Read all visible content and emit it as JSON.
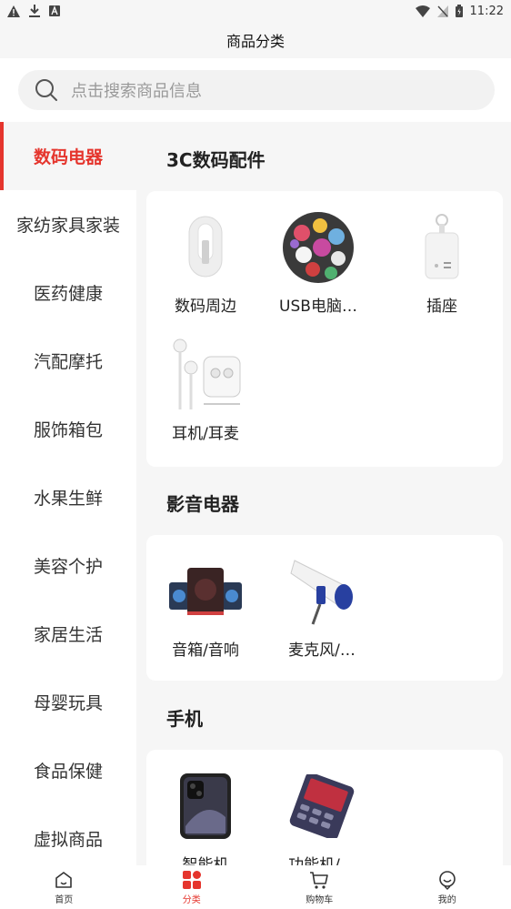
{
  "status_bar": {
    "time": "11:22"
  },
  "header": {
    "title": "商品分类"
  },
  "search": {
    "placeholder": "点击搜索商品信息"
  },
  "sidebar": {
    "items": [
      {
        "label": "数码电器"
      },
      {
        "label": "家纺家具家装"
      },
      {
        "label": "医药健康"
      },
      {
        "label": "汽配摩托"
      },
      {
        "label": "服饰箱包"
      },
      {
        "label": "水果生鲜"
      },
      {
        "label": "美容个护"
      },
      {
        "label": "家居生活"
      },
      {
        "label": "母婴玩具"
      },
      {
        "label": "食品保健"
      },
      {
        "label": "虚拟商品"
      }
    ]
  },
  "sections": [
    {
      "title": "3C数码配件",
      "items": [
        {
          "label": "数码周边",
          "icon": "cable-icon"
        },
        {
          "label": "USB电脑…",
          "icon": "sticker-pack-icon"
        },
        {
          "label": "插座",
          "icon": "socket-icon"
        },
        {
          "label": "耳机/耳麦",
          "icon": "earphones-icon"
        }
      ]
    },
    {
      "title": "影音电器",
      "items": [
        {
          "label": "音箱/音响",
          "icon": "speaker-icon"
        },
        {
          "label": "麦克风/…",
          "icon": "megaphone-icon"
        }
      ]
    },
    {
      "title": "手机",
      "items": [
        {
          "label": "智能机",
          "icon": "smartphone-icon"
        },
        {
          "label": "功能机/…",
          "icon": "feature-phone-icon"
        }
      ]
    }
  ],
  "tabbar": {
    "items": [
      {
        "label": "首页"
      },
      {
        "label": "分类"
      },
      {
        "label": "购物车"
      },
      {
        "label": "我的"
      }
    ]
  },
  "colors": {
    "accent": "#e5352d",
    "background": "#f6f6f6"
  }
}
